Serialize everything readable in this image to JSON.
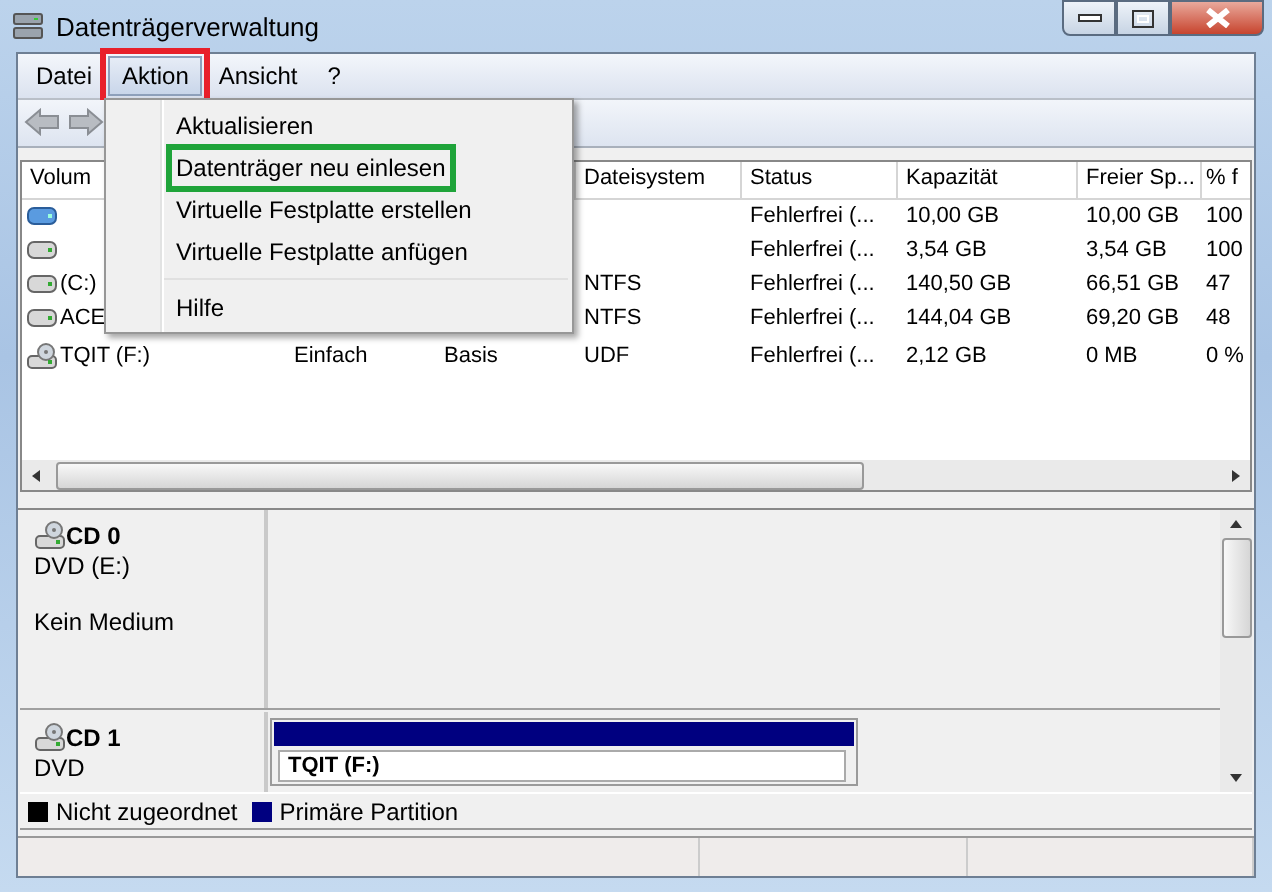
{
  "window": {
    "title": "Datenträgerverwaltung"
  },
  "menu_bar": [
    {
      "label": "Datei",
      "selected": false,
      "marked": false
    },
    {
      "label": "Aktion",
      "selected": true,
      "marked": true
    },
    {
      "label": "Ansicht",
      "selected": false,
      "marked": false
    },
    {
      "label": "?",
      "selected": false,
      "marked": false
    }
  ],
  "volume_table": {
    "columns": [
      "Volum",
      null,
      null,
      "Dateisystem",
      "Status",
      "Kapazität",
      "Freier Sp...",
      "% f"
    ],
    "rows": [
      {
        "kind": "virtual",
        "cells": [
          null,
          null,
          null,
          null,
          "Fehlerfrei (...",
          "10,00 GB",
          "10,00 GB",
          "100"
        ]
      },
      {
        "kind": "disk",
        "cells": [
          null,
          null,
          null,
          null,
          "Fehlerfrei (...",
          "3,54 GB",
          "3,54 GB",
          "100"
        ]
      },
      {
        "kind": "disk",
        "cells": [
          "(C:)",
          null,
          null,
          "NTFS",
          "Fehlerfrei (...",
          "140,50 GB",
          "66,51 GB",
          "47"
        ]
      },
      {
        "kind": "disk",
        "cells": [
          "ACE",
          null,
          null,
          "NTFS",
          "Fehlerfrei (...",
          "144,04 GB",
          "69,20 GB",
          "48"
        ]
      },
      {
        "kind": "optical",
        "cells": [
          "TQIT (F:)",
          "Einfach",
          "Basis",
          "UDF",
          "Fehlerfrei (...",
          "2,12 GB",
          "0 MB",
          "0 %"
        ]
      }
    ]
  },
  "context_menu": {
    "items": [
      {
        "kind": "item",
        "label": "Aktualisieren",
        "marked": false
      },
      {
        "kind": "item",
        "label": "Datenträger neu einlesen",
        "marked": true
      },
      {
        "kind": "item",
        "label": "Virtuelle Festplatte erstellen",
        "marked": false
      },
      {
        "kind": "item",
        "label": "Virtuelle Festplatte anfügen",
        "marked": false
      },
      {
        "kind": "separator"
      },
      {
        "kind": "item",
        "label": "Hilfe",
        "marked": false
      }
    ]
  },
  "disks": [
    {
      "name": "CD 0",
      "type": "DVD (E:)",
      "status": "Kein Medium"
    },
    {
      "name": "CD 1",
      "type": "DVD",
      "partitions": [
        {
          "label": "TQIT  (F:)",
          "color": "#000080"
        }
      ]
    }
  ],
  "legend": [
    {
      "label": "Nicht zugeordnet",
      "color": "#000000"
    },
    {
      "label": "Primäre Partition",
      "color": "#000080"
    }
  ]
}
